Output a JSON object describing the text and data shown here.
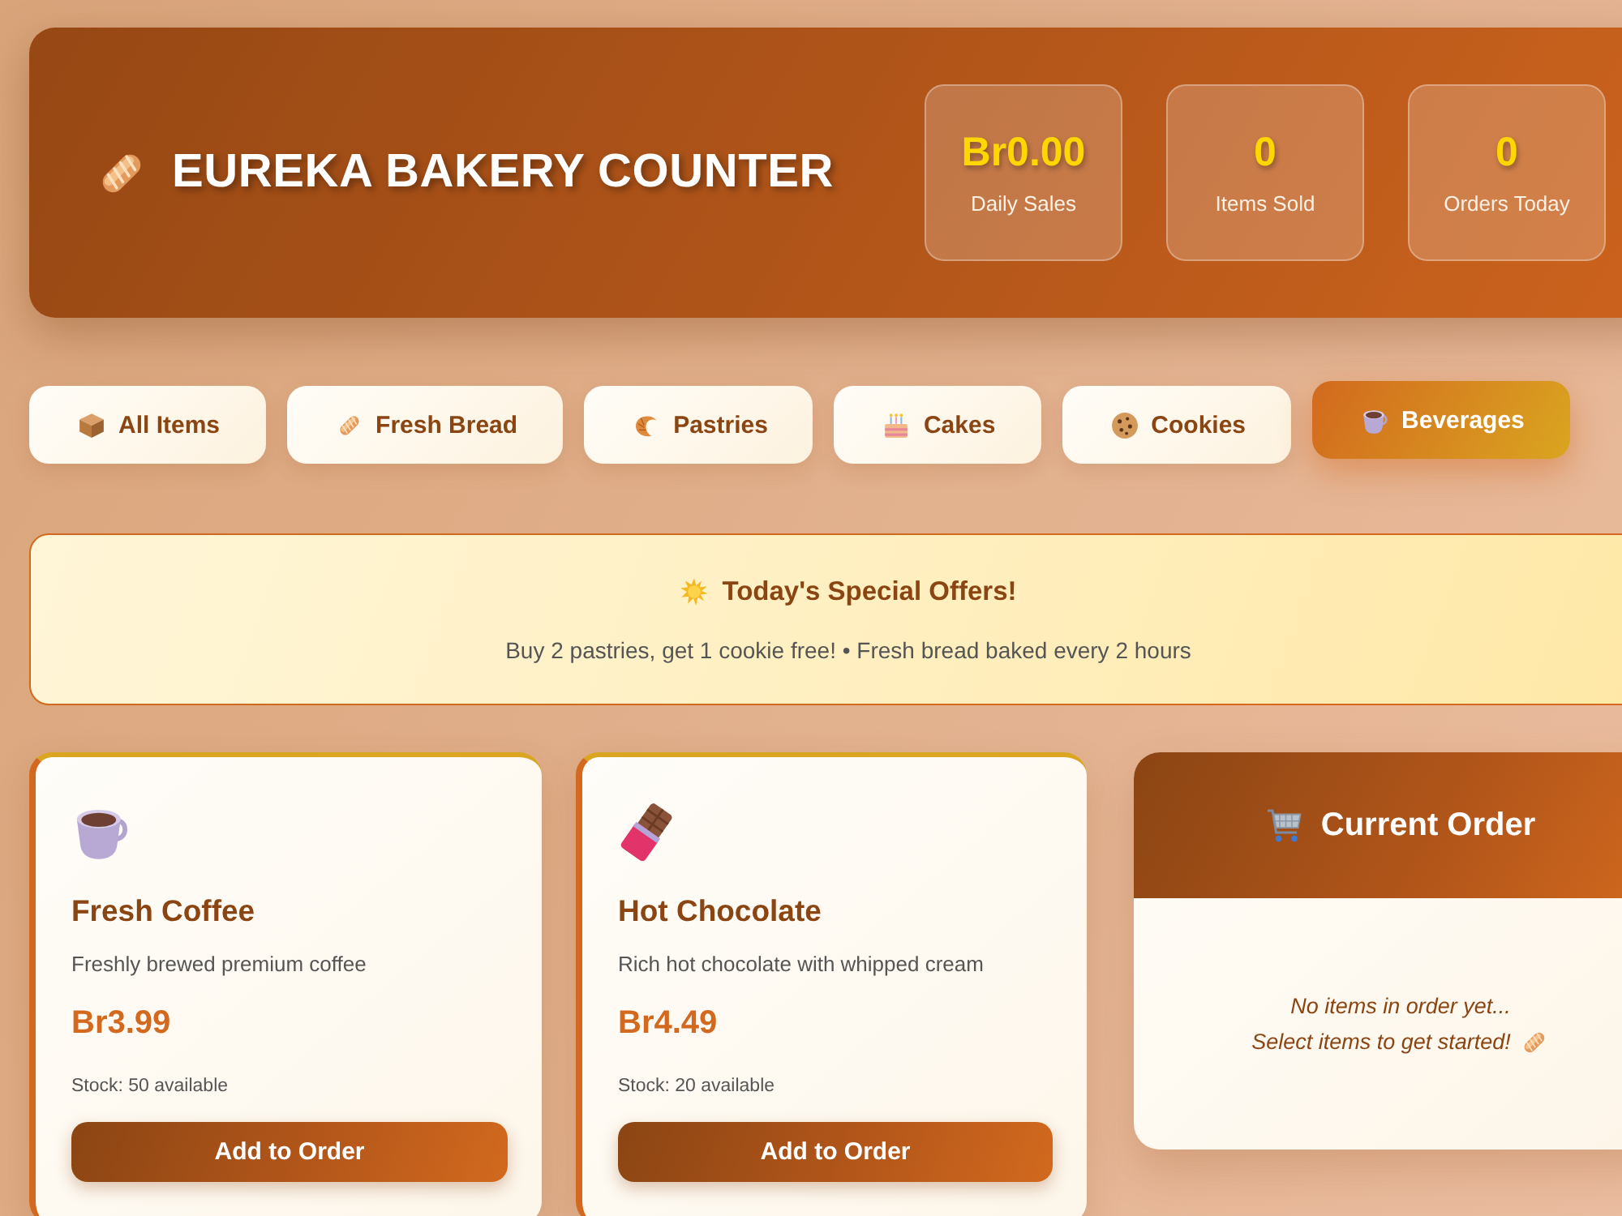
{
  "header": {
    "title": "EUREKA BAKERY COUNTER",
    "stats": [
      {
        "value": "Br0.00",
        "label": "Daily Sales"
      },
      {
        "value": "0",
        "label": "Items Sold"
      },
      {
        "value": "0",
        "label": "Orders Today"
      }
    ]
  },
  "categories": [
    {
      "label": "All Items",
      "selected": false
    },
    {
      "label": "Fresh Bread",
      "selected": false
    },
    {
      "label": "Pastries",
      "selected": false
    },
    {
      "label": "Cakes",
      "selected": false
    },
    {
      "label": "Cookies",
      "selected": false
    },
    {
      "label": "Beverages",
      "selected": true
    }
  ],
  "special_offers": {
    "title": "Today's Special Offers!",
    "text": "Buy 2 pastries, get 1 cookie free! • Fresh bread baked every 2 hours"
  },
  "products": [
    {
      "name": "Fresh Coffee",
      "description": "Freshly brewed premium coffee",
      "price": "Br3.99",
      "stock": "Stock: 50 available",
      "button": "Add to Order"
    },
    {
      "name": "Hot Chocolate",
      "description": "Rich hot chocolate with whipped cream",
      "price": "Br4.49",
      "stock": "Stock: 20 available",
      "button": "Add to Order"
    }
  ],
  "order": {
    "title": "Current Order",
    "empty_message": [
      "No items in order yet...",
      "Select items to get started!"
    ]
  }
}
